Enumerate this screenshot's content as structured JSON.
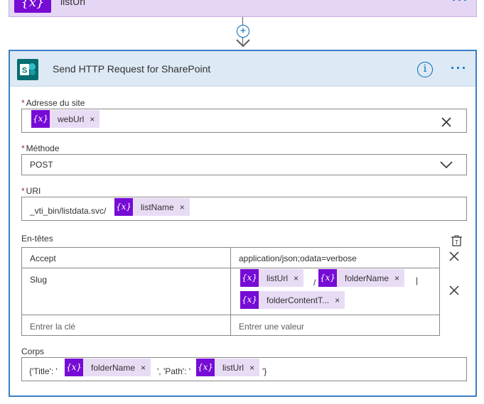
{
  "top_card": {
    "title": "listUrl",
    "icon": "variable-icon",
    "icon_glyph": "{x}",
    "menu": "···"
  },
  "connector": {
    "plus": "+"
  },
  "action": {
    "title": "Send HTTP Request for SharePoint",
    "icon": "sharepoint-icon",
    "info": "i",
    "menu": "···"
  },
  "site_address": {
    "label": "Adresse du site",
    "required": "*",
    "token": {
      "label": "webUrl",
      "remove": "×"
    }
  },
  "method": {
    "label": "Méthode",
    "required": "*",
    "value": "POST"
  },
  "uri": {
    "label": "URI",
    "required": "*",
    "prefix": "_vti_bin/listdata.svc/",
    "token": {
      "label": "listName",
      "remove": "×"
    }
  },
  "headers": {
    "label": "En-têtes",
    "rows": [
      {
        "key": "Accept",
        "value": "application/json;odata=verbose"
      },
      {
        "key": "Slug",
        "tokens": [
          "listUrl",
          "folderName",
          "folderContentT..."
        ],
        "sep": "/",
        "trail": "|"
      },
      {
        "key_placeholder": "Entrer la clé",
        "value_placeholder": "Entrer une valeur"
      }
    ],
    "remove": "×"
  },
  "body": {
    "label": "Corps",
    "part1": "{'Title': '",
    "token1": "folderName",
    "part2": "', 'Path': '",
    "token2": "listUrl",
    "part3": "'}",
    "remove": "×"
  },
  "colors": {
    "accent": "#0067b8",
    "variable": "#770bd6",
    "token_bg": "#e8dcf5",
    "sharepoint": "#036c70",
    "required": "#a4262c"
  }
}
